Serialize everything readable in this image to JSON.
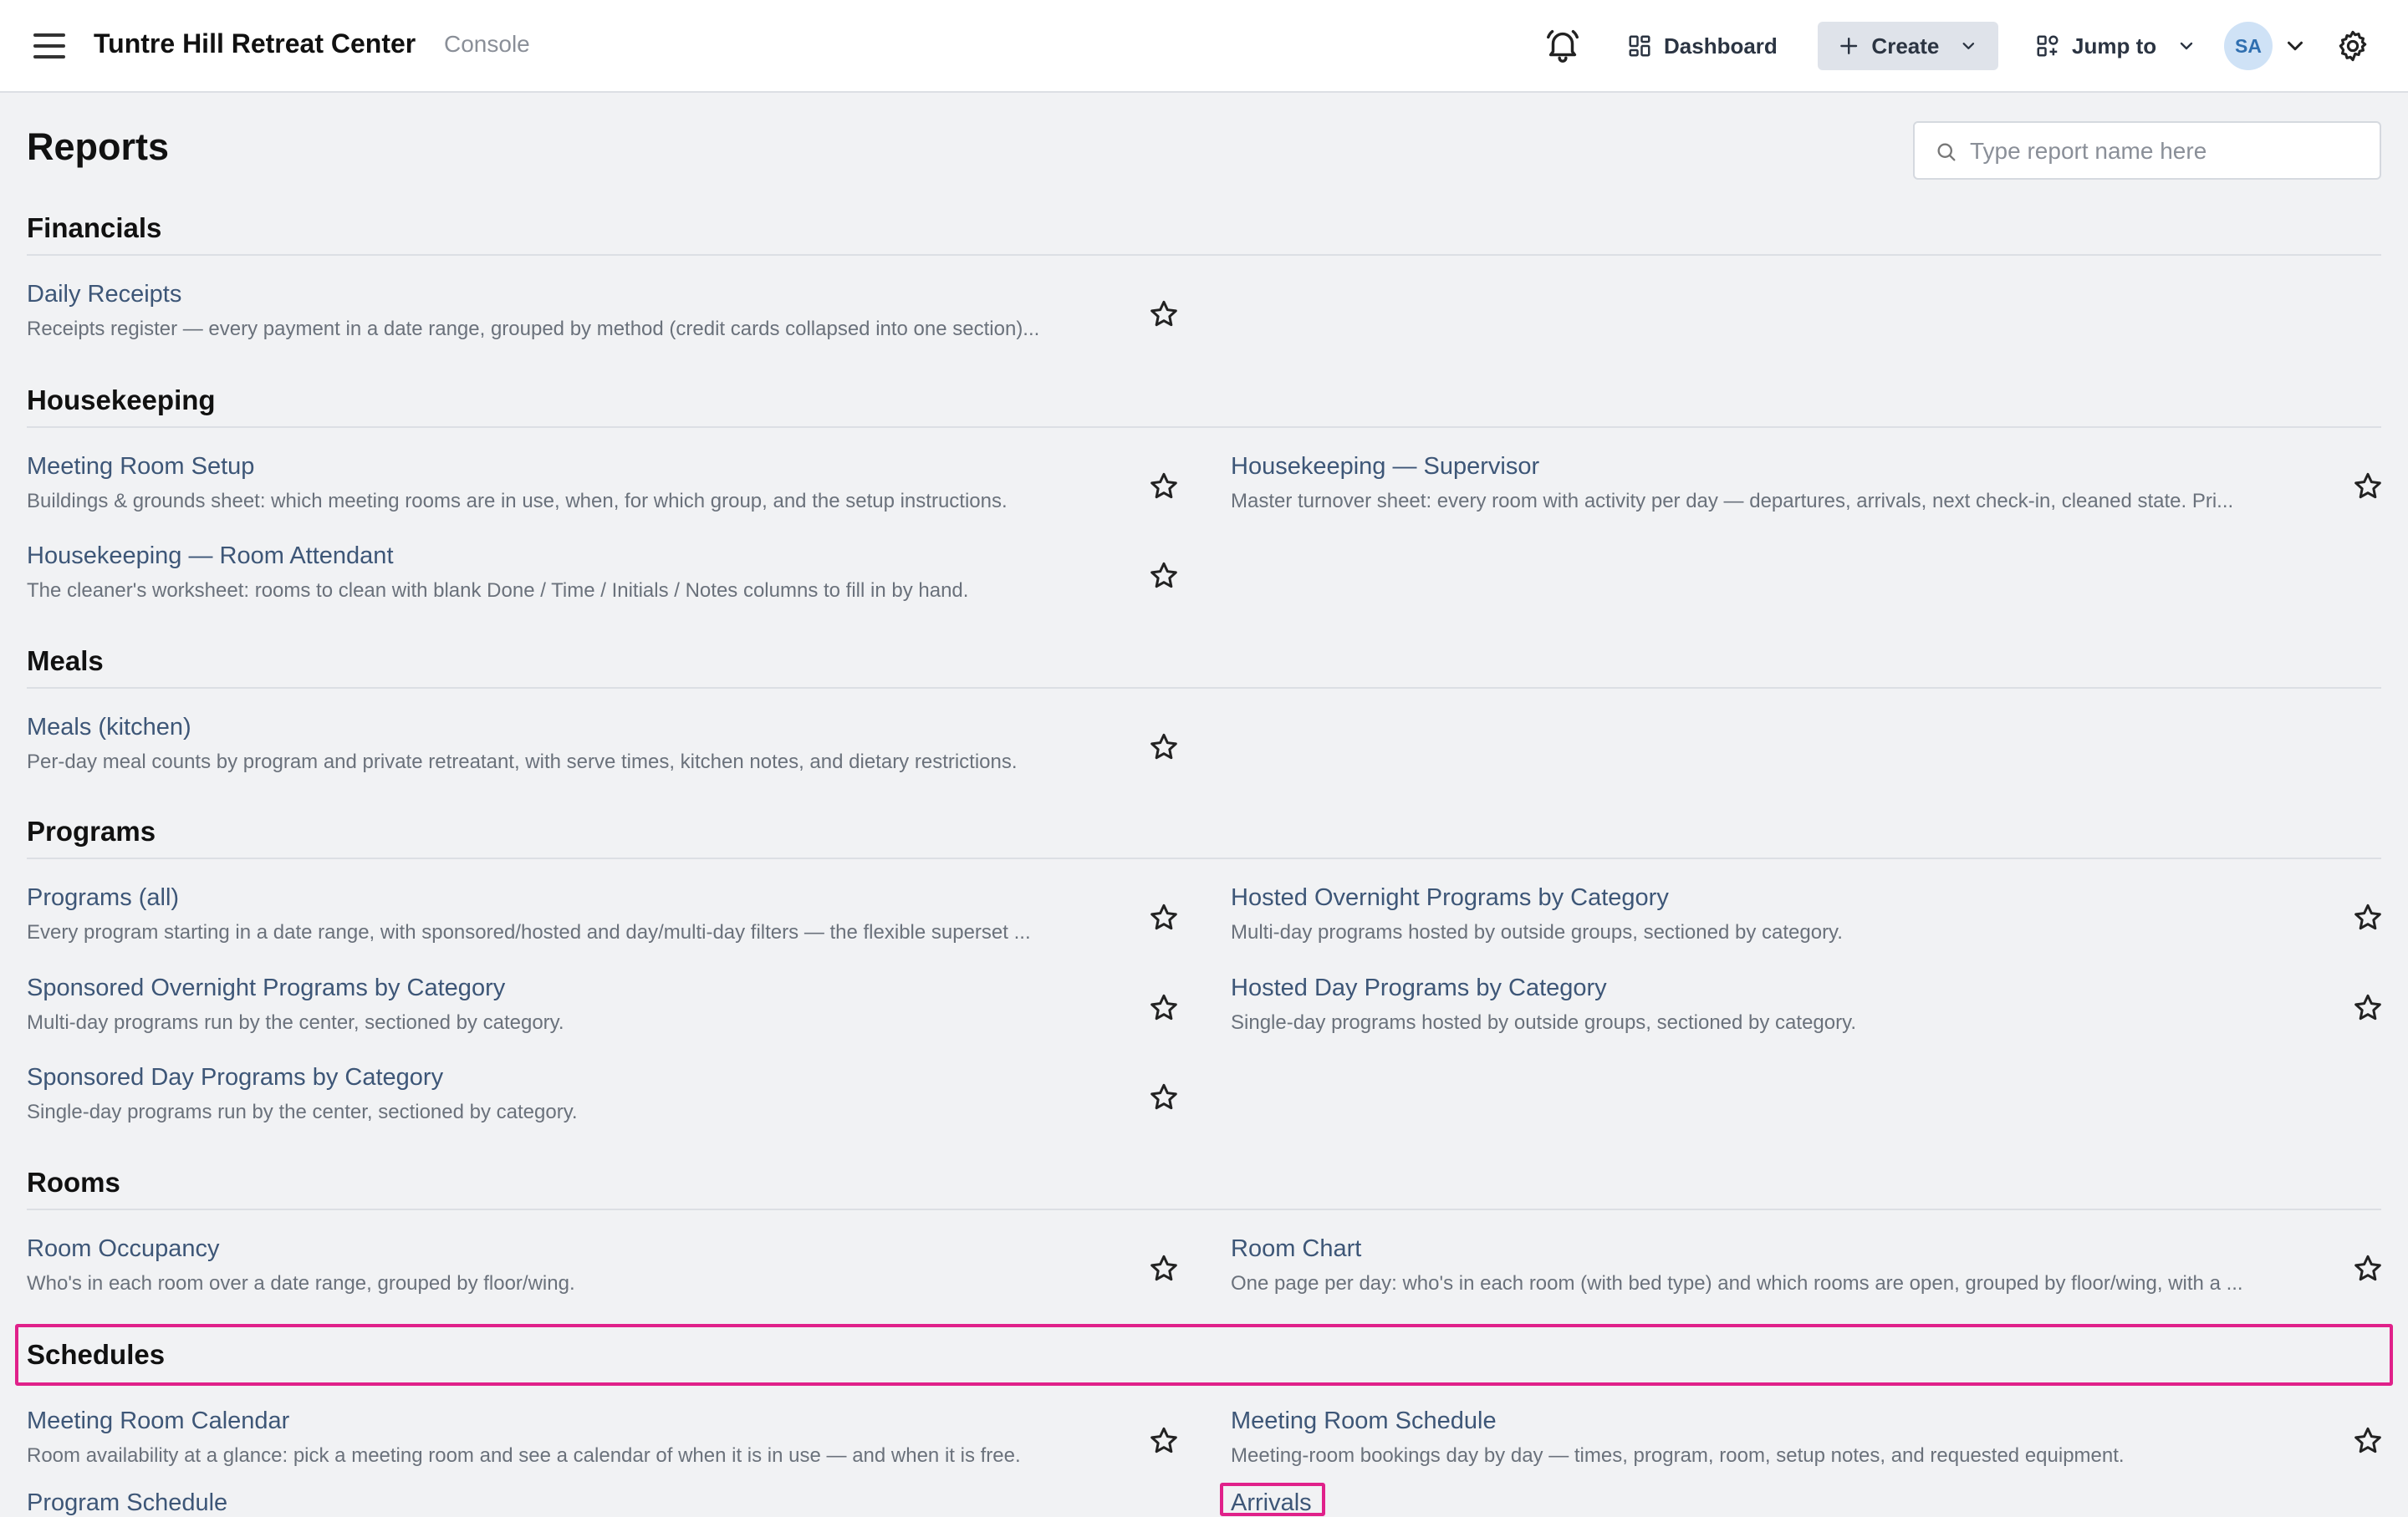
{
  "header": {
    "app_title": "Tuntre Hill Retreat Center",
    "app_subtitle": "Console",
    "dashboard_label": "Dashboard",
    "create_label": "Create",
    "jump_label": "Jump to",
    "avatar_initials": "SA"
  },
  "page": {
    "title": "Reports",
    "search_placeholder": "Type report name here"
  },
  "sections": {
    "financials": {
      "title": "Financials",
      "items": [
        {
          "title": "Daily Receipts",
          "desc": "Receipts register — every payment in a date range, grouped by method (credit cards collapsed into one section)..."
        }
      ]
    },
    "housekeeping": {
      "title": "Housekeeping",
      "items": [
        {
          "title": "Meeting Room Setup",
          "desc": "Buildings & grounds sheet: which meeting rooms are in use, when, for which group, and the setup instructions."
        },
        {
          "title": "Housekeeping — Supervisor",
          "desc": "Master turnover sheet: every room with activity per day — departures, arrivals, next check-in, cleaned state. Pri..."
        },
        {
          "title": "Housekeeping — Room Attendant",
          "desc": "The cleaner's worksheet: rooms to clean with blank Done / Time / Initials / Notes columns to fill in by hand."
        }
      ]
    },
    "meals": {
      "title": "Meals",
      "items": [
        {
          "title": "Meals (kitchen)",
          "desc": "Per-day meal counts by program and private retreatant, with serve times, kitchen notes, and dietary restrictions."
        }
      ]
    },
    "programs": {
      "title": "Programs",
      "items": [
        {
          "title": "Programs (all)",
          "desc": "Every program starting in a date range, with sponsored/hosted and day/multi-day filters — the flexible superset ..."
        },
        {
          "title": "Hosted Overnight Programs by Category",
          "desc": "Multi-day programs hosted by outside groups, sectioned by category."
        },
        {
          "title": "Sponsored Overnight Programs by Category",
          "desc": "Multi-day programs run by the center, sectioned by category."
        },
        {
          "title": "Hosted Day Programs by Category",
          "desc": "Single-day programs hosted by outside groups, sectioned by category."
        },
        {
          "title": "Sponsored Day Programs by Category",
          "desc": "Single-day programs run by the center, sectioned by category."
        }
      ]
    },
    "rooms": {
      "title": "Rooms",
      "items": [
        {
          "title": "Room Occupancy",
          "desc": "Who's in each room over a date range, grouped by floor/wing."
        },
        {
          "title": "Room Chart",
          "desc": "One page per day: who's in each room (with bed type) and which rooms are open, grouped by floor/wing, with a ..."
        }
      ]
    },
    "schedules": {
      "title": "Schedules",
      "items": [
        {
          "title": "Meeting Room Calendar",
          "desc": "Room availability at a glance: pick a meeting room and see a calendar of when it is in use — and when it is free."
        },
        {
          "title": "Meeting Room Schedule",
          "desc": "Meeting-room bookings day by day — times, program, room, setup notes, and requested equipment."
        },
        {
          "title": "Program Schedule",
          "desc": ""
        },
        {
          "title": "Arrivals",
          "desc": ""
        }
      ]
    }
  },
  "colors": {
    "link": "#3d5677",
    "highlight": "#e0218a",
    "background": "#f1f2f4"
  },
  "icons": [
    "menu-icon",
    "bell-icon",
    "dashboard-icon",
    "plus-icon",
    "chevron-down-icon",
    "jump-icon",
    "gear-icon",
    "search-icon",
    "star-icon"
  ]
}
